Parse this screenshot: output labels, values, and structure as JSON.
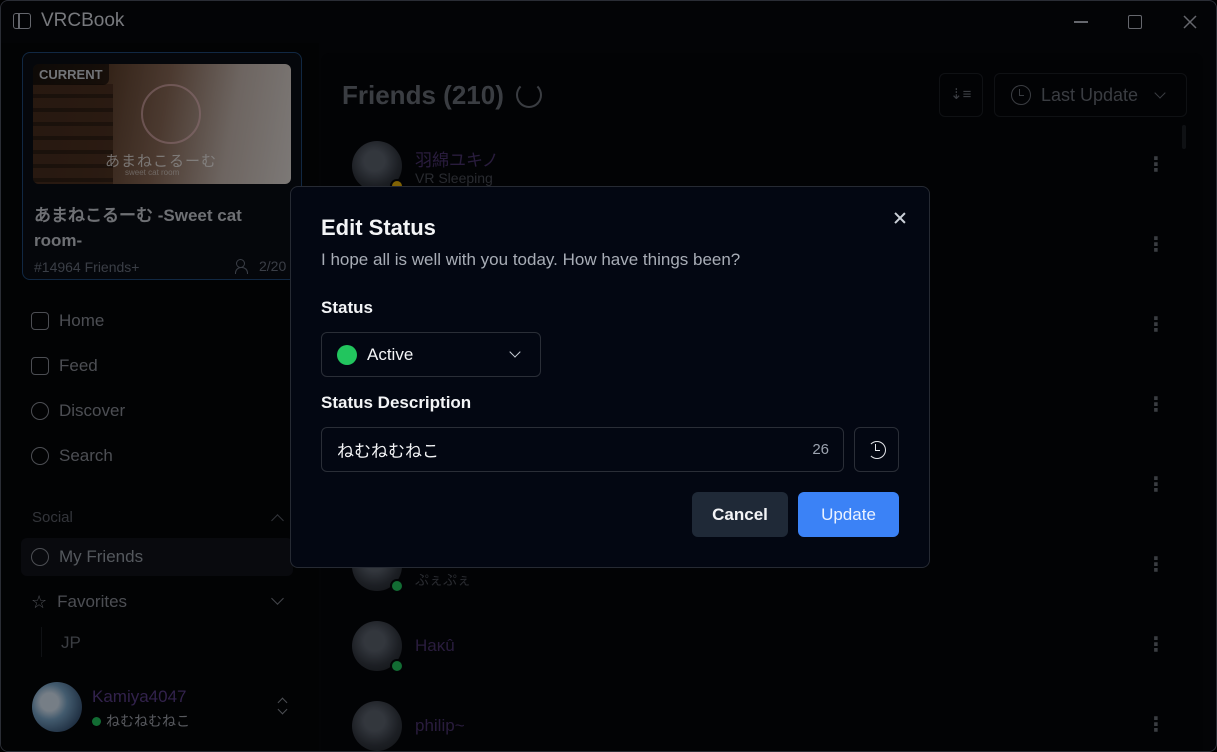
{
  "app": {
    "title": "VRCBook"
  },
  "current_world": {
    "badge": "CURRENT",
    "thumb_text": "あまねこるーむ",
    "thumb_subtext": "sweet cat room",
    "name": "あまねこるーむ -Sweet cat room-",
    "instance": "#14964 Friends+",
    "users": "2/20"
  },
  "nav": {
    "home": "Home",
    "feed": "Feed",
    "discover": "Discover",
    "search": "Search",
    "social_label": "Social",
    "my_friends": "My Friends",
    "favorites": "Favorites",
    "favorites_sub": "JP"
  },
  "me": {
    "name": "Kamiya4047",
    "status": "ねむねむねこ"
  },
  "friends": {
    "title": "Friends",
    "count": "(210)",
    "order_by": "Last Update",
    "rows": [
      {
        "name": "羽綿ユキノ",
        "status": "VR Sleeping",
        "dot": "#eab308"
      },
      {
        "name": "",
        "status": "ぷぇぷぇ",
        "dot": "#22c55e"
      },
      {
        "name": "Haκû",
        "status": "",
        "dot": "#22c55e"
      },
      {
        "name": "philip~",
        "status": "",
        "dot": "#22c55e"
      }
    ]
  },
  "dialog": {
    "title": "Edit Status",
    "description": "I hope all is well with you today. How have things been?",
    "status_label": "Status",
    "status_value": "Active",
    "status_desc_label": "Status Description",
    "status_desc_value": "ねむねむねこ",
    "char_count": "26",
    "cancel": "Cancel",
    "update": "Update"
  },
  "colors": {
    "active_green": "#22c55e",
    "primary_blue": "#3b82f6",
    "friend_name_purple": "#4b3470"
  }
}
